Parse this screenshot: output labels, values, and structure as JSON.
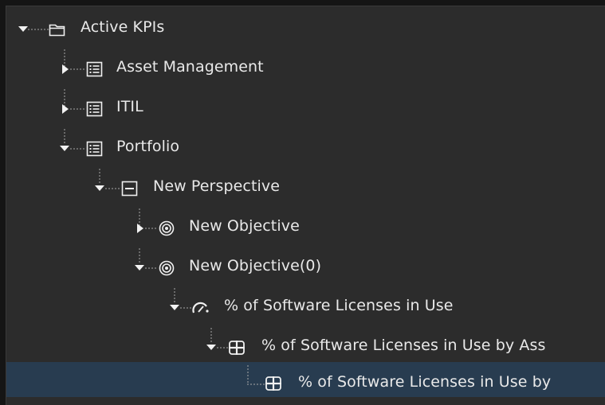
{
  "tree": {
    "items": [
      {
        "label": "Active KPIs",
        "icon": "folder-icon",
        "state": "expanded",
        "selected": false
      },
      {
        "label": "Asset Management",
        "icon": "list-icon",
        "state": "collapsed",
        "selected": false
      },
      {
        "label": "ITIL",
        "icon": "list-icon",
        "state": "collapsed",
        "selected": false
      },
      {
        "label": "Portfolio",
        "icon": "list-icon",
        "state": "expanded",
        "selected": false
      },
      {
        "label": "New Perspective",
        "icon": "perspective-icon",
        "state": "expanded",
        "selected": false
      },
      {
        "label": "New Objective",
        "icon": "target-icon",
        "state": "collapsed",
        "selected": false
      },
      {
        "label": "New Objective(0)",
        "icon": "target-icon",
        "state": "expanded",
        "selected": false
      },
      {
        "label": "% of Software Licenses in Use",
        "icon": "gauge-icon",
        "state": "expanded",
        "selected": false
      },
      {
        "label": "% of Software Licenses in Use by Ass",
        "icon": "kpi-quadrant-icon",
        "state": "expanded",
        "selected": false
      },
      {
        "label": "% of Software Licenses in Use by",
        "icon": "kpi-quadrant-icon",
        "state": "leaf",
        "selected": true
      }
    ]
  },
  "colors": {
    "background": "#2c2c2c",
    "selection": "#283c50",
    "text": "#e9e9e9",
    "connector": "#a8a8a8"
  }
}
